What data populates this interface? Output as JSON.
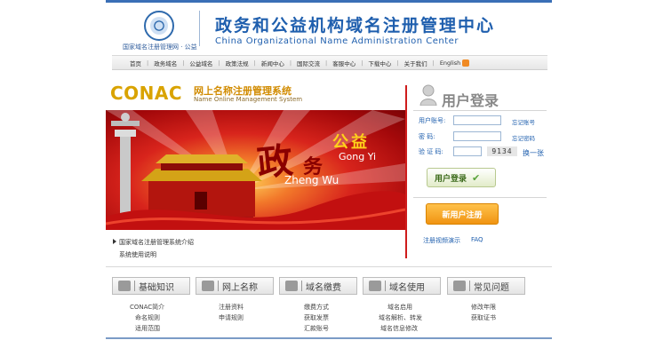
{
  "header": {
    "logo_caption": "国家域名注册管理网 · 公益",
    "title_cn": "政务和公益机构域名注册管理中心",
    "title_en": "China Organizational Name Administration Center"
  },
  "nav": [
    "首页",
    "政务域名",
    "公益域名",
    "政策法规",
    "新闻中心",
    "国际交流",
    "客服中心",
    "下载中心",
    "关于我们",
    "English"
  ],
  "brand": {
    "conac": "CONAC",
    "system_cn": "网上名称注册管理系统",
    "system_en": "Name Online Management System"
  },
  "banner": {
    "zheng": "政",
    "wu": "务",
    "zhengwu_en": "Zheng Wu",
    "gongyi_cn": "公益",
    "gongyi_en": "Gong Yi"
  },
  "intro": {
    "link1": "国家域名注册管理系统介绍",
    "link2": "系统使用说明"
  },
  "login": {
    "title": "用户登录",
    "account_label": "用户账号:",
    "password_label": "密    码:",
    "captcha_label": "验 证 码:",
    "forgot_account": "忘记账号",
    "forgot_password": "忘记密码",
    "captcha_value": "9134",
    "refresh": "换一张",
    "login_button": "用户登录",
    "register_button": "新用户注册",
    "video_demo": "注册视频演示",
    "faq": "FAQ"
  },
  "categories": [
    {
      "title": "基础知识",
      "items": [
        "CONAC简介",
        "命名规则",
        "适用范围"
      ]
    },
    {
      "title": "网上名称",
      "items": [
        "注册资料",
        "申请规则"
      ]
    },
    {
      "title": "域名缴费",
      "items": [
        "缴费方式",
        "获取发票",
        "汇款账号"
      ]
    },
    {
      "title": "域名使用",
      "items": [
        "域名启用",
        "域名解析、转发",
        "域名信息修改"
      ]
    },
    {
      "title": "常见问题",
      "items": [
        "修改年限",
        "获取证书"
      ]
    }
  ]
}
